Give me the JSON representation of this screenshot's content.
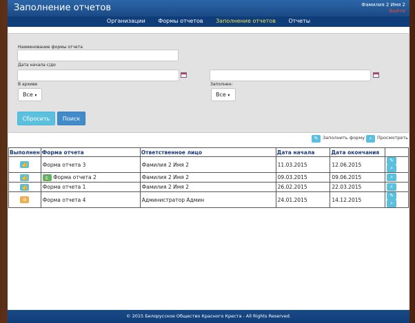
{
  "header": {
    "title": "Заполнение отчетов",
    "user_name": "Фамилия 2 Имя 2",
    "logout": "Выйти"
  },
  "nav": {
    "items": [
      {
        "label": "Организации"
      },
      {
        "label": "Формы отчетов"
      },
      {
        "label": "Заполнение отчетов",
        "active": true
      },
      {
        "label": "Отчеты"
      }
    ]
  },
  "filters": {
    "form_name_label": "Наименование формы отчета",
    "form_name_value": "",
    "date_label": "Дата начала с/до",
    "date_from_value": "",
    "date_to_value": "",
    "archive_label": "В архиве",
    "archive_value": "Все",
    "filled_label": "Заполнен:",
    "filled_value": "Все",
    "reset_button": "Сбросить",
    "search_button": "Поиск"
  },
  "legend": {
    "fill_label": "Заполнить форму",
    "view_label": "Просмотреть"
  },
  "table": {
    "headers": [
      "Выполнен",
      "Форма отчета",
      "Ответственное лицо",
      "Дата начала",
      "Дата окончания",
      ""
    ],
    "rows": [
      {
        "status": "thumbs-up-icon",
        "status_color": "#5bc0de",
        "form": "Форма отчета 3",
        "responsible": "Фамилия 2 Имя 2",
        "start": "11.03.2015",
        "end": "12.06.2015",
        "actions": [
          "edit",
          "view"
        ]
      },
      {
        "status": "thumbs-up-icon",
        "status_color": "#5bc0de",
        "form": "Форма отчета 2",
        "form_icon": "hourglass-icon",
        "responsible": "Фамилия 2 Имя 2",
        "start": "09.03.2015",
        "end": "09.06.2015",
        "actions": [
          "view"
        ]
      },
      {
        "status": "thumbs-up-icon",
        "status_color": "#5bc0de",
        "form": "Форма отчета 1",
        "responsible": "Фамилия 2 Имя 2",
        "start": "26.02.2015",
        "end": "22.03.2015",
        "actions": [
          "view"
        ]
      },
      {
        "status": "ban-icon",
        "status_color": "#f0ad4e",
        "form": "Форма отчета 4",
        "responsible": "Администратор Админ",
        "start": "24.01.2015",
        "end": "14.12.2015",
        "actions": [
          "edit",
          "view"
        ]
      }
    ]
  },
  "footer": {
    "text": "© 2015 Белорусское Общество Красного Креста  -   All Rights Reserved."
  },
  "colors": {
    "header_blue": "#1a4a85",
    "nav_active": "#e8e24a",
    "accent_info": "#5bc0de",
    "accent_primary": "#428bca",
    "warning": "#f0ad4e",
    "logout_red": "#e64a3a"
  }
}
